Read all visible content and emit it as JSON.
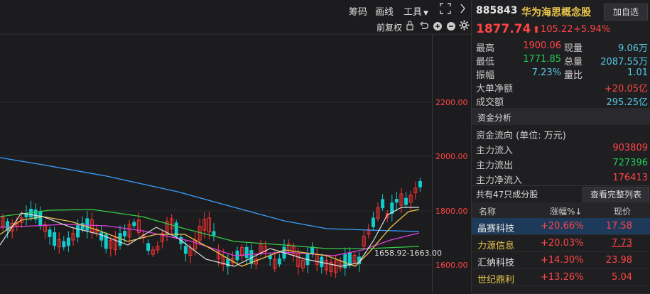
{
  "toolbar": {
    "chip_label": "筹码",
    "draw_label": "画线",
    "tools_label": "工具",
    "adjust_label": "前复权"
  },
  "chart": {
    "y_ticks": [
      "2200.00",
      "2000.00",
      "1800.00",
      "1600.00"
    ],
    "annotation": "1658.92-1663.00",
    "colors": {
      "up": "#ff3333",
      "down": "#11cccc",
      "ma_white": "#e0e0e0",
      "ma_yellow": "#e8c54a",
      "ma_magenta": "#e040e0",
      "ma_green": "#33cc44",
      "ma_blue": "#3aa0ff",
      "tick_text": "#ff4444"
    }
  },
  "header": {
    "code": "885843",
    "name": "华为海思概念股",
    "add_button": "加自选",
    "price": "1877.74",
    "price_arrow": "⬆",
    "change": "105.22",
    "change_pct": "+5.94%"
  },
  "quote": [
    {
      "label": "最高",
      "value": "1900.06",
      "label2": "现量",
      "value2": "9.06万"
    },
    {
      "label": "最低",
      "value": "1771.85",
      "label2": "总量",
      "value2": "2087.55万"
    },
    {
      "label": "振幅",
      "value": "7.23%",
      "label2": "量比",
      "value2": "1.01"
    }
  ],
  "big_order": {
    "label": "大单净额",
    "value": "+20.05亿"
  },
  "turnover": {
    "label": "成交额",
    "value": "295.25亿"
  },
  "fund_analysis": {
    "title": "资金分析",
    "direction": "资金流向 (单位: 万元)",
    "rows": [
      {
        "label": "主力流入",
        "value": "903809"
      },
      {
        "label": "主力流出",
        "value": "727396"
      },
      {
        "label": "主力净流入",
        "value": "176413"
      }
    ]
  },
  "constituents": {
    "count_label": "共有47只成分股",
    "view_button": "查看完整列表",
    "headers": {
      "name": "名称",
      "change": "涨幅%↓",
      "price": "现价"
    },
    "rows": [
      {
        "name": "晶赛科技",
        "change": "+20.66%",
        "price": "17.58"
      },
      {
        "name": "力源信息",
        "change": "+20.03%",
        "price": "7.73"
      },
      {
        "name": "汇纳科技",
        "change": "+14.30%",
        "price": "23.98"
      },
      {
        "name": "世纪鼎利",
        "change": "+13.26%",
        "price": "5.04"
      }
    ]
  }
}
